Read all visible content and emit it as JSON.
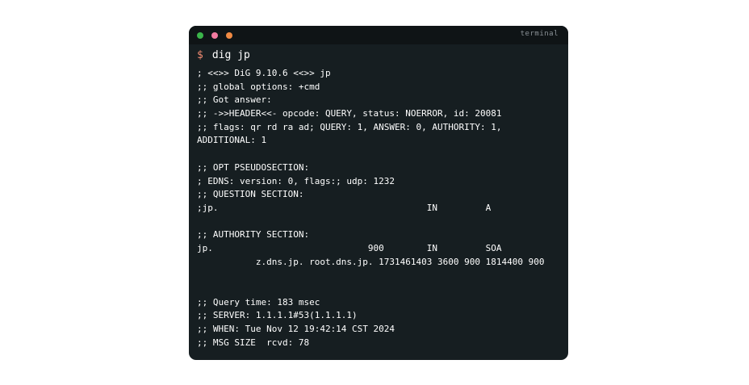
{
  "colors": {
    "terminal_bg": "#161e21",
    "titlebar_bg": "#0f1416",
    "light_green": "#3bb54a",
    "light_pink": "#f27ba0",
    "light_orange": "#f08a43",
    "prompt": "#f08a72",
    "text": "#ffffff"
  },
  "window": {
    "title": "terminal"
  },
  "prompt": {
    "symbol": "$",
    "command": "dig jp"
  },
  "output": {
    "lines": [
      "; <<>> DiG 9.10.6 <<>> jp",
      ";; global options: +cmd",
      ";; Got answer:",
      ";; ->>HEADER<<- opcode: QUERY, status: NOERROR, id: 20081",
      ";; flags: qr rd ra ad; QUERY: 1, ANSWER: 0, AUTHORITY: 1,",
      "ADDITIONAL: 1",
      "",
      ";; OPT PSEUDOSECTION:",
      "; EDNS: version: 0, flags:; udp: 1232",
      ";; QUESTION SECTION:",
      ";jp.                                       IN         A",
      "",
      ";; AUTHORITY SECTION:",
      "jp.                             900        IN         SOA",
      "           z.dns.jp. root.dns.jp. 1731461403 3600 900 1814400 900",
      "",
      "",
      ";; Query time: 183 msec",
      ";; SERVER: 1.1.1.1#53(1.1.1.1)",
      ";; WHEN: Tue Nov 12 19:42:14 CST 2024",
      ";; MSG SIZE  rcvd: 78"
    ]
  }
}
